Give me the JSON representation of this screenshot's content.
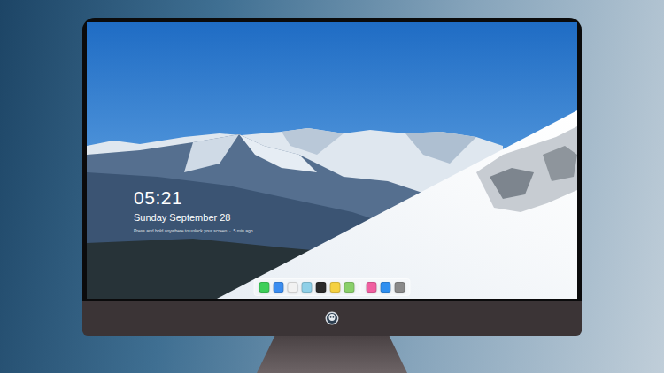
{
  "lock_screen": {
    "time": "05:21",
    "date": "Sunday September 28",
    "notice": "Press and hold anywhere to unlock your screen  ·  5 min ago"
  },
  "dock": {
    "apps": [
      {
        "color": "#3ecf5a"
      },
      {
        "color": "#3b8df0"
      },
      {
        "color": "#f2f2f2"
      },
      {
        "color": "#8fd0e8"
      },
      {
        "color": "#2b2b2b"
      },
      {
        "color": "#f5d142"
      },
      {
        "color": "#8ad06a"
      }
    ],
    "utilities": [
      {
        "color": "#f05fa0"
      },
      {
        "color": "#2f8ff0"
      },
      {
        "color": "#8a8a8a"
      }
    ]
  }
}
